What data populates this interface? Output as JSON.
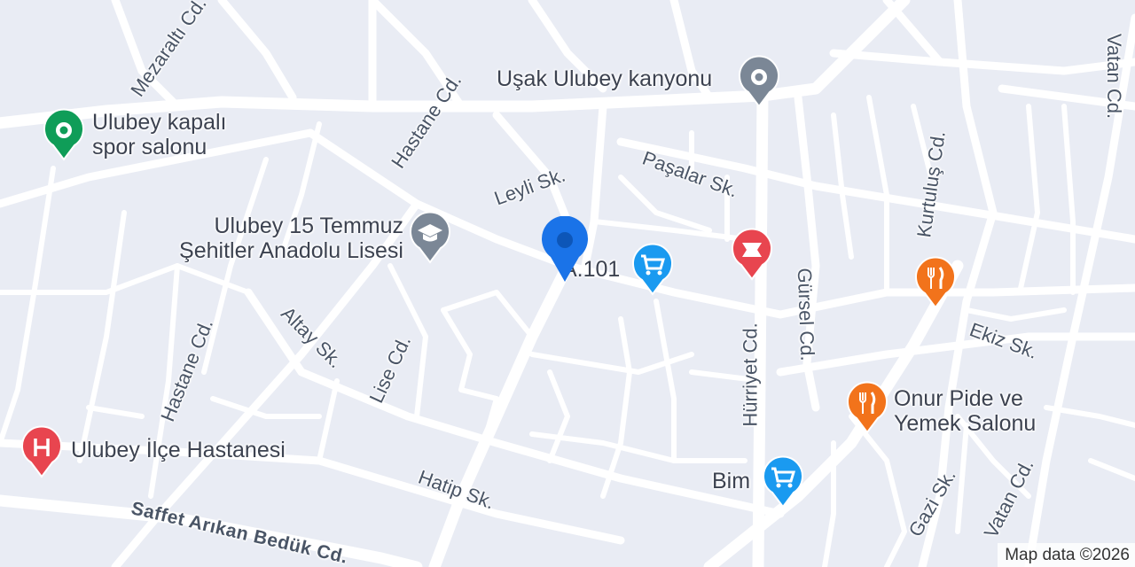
{
  "map": {
    "attribution": "Map data ©2026",
    "streets": {
      "mezaralti": "Mezaraltı Cd.",
      "hastane_top": "Hastane Cd.",
      "hastane_left": "Hastane Cd.",
      "leyli": "Leyli Sk.",
      "pasalar": "Paşalar Sk.",
      "kurtulus": "Kurtuluş Cd.",
      "vatan_top": "Vatan Cd.",
      "vatan_bottom": "Vatan Cd.",
      "gursel": "Gürsel Cd.",
      "hurriyet": "Hürriyet Cd.",
      "ekiz": "Ekiz Sk.",
      "altay": "Altay Sk.",
      "lise": "Lise Cd.",
      "hatip": "Hatip Sk.",
      "saffet": "Saffet Arıkan Bedük Cd.",
      "gazi": "Gazi Sk."
    },
    "pois": {
      "kanyon": "Uşak Ulubey kanyonu",
      "spor_line1": "Ulubey kapalı",
      "spor_line2": "spor salonu",
      "lise_line1": "Ulubey 15 Temmuz",
      "lise_line2": "Şehitler Anadolu Lisesi",
      "a101": "A.101",
      "onur_line1": "Onur Pide ve",
      "onur_line2": "Yemek Salonu",
      "bim": "Bim",
      "hastane": "Ulubey İlçe Hastanesi"
    },
    "icons": {
      "kanyon": "landmark-icon",
      "spor": "sports-icon",
      "lise": "school-icon",
      "a101": "shopping-cart-icon",
      "pharmacy": "pharmacy-icon",
      "restaurant1": "restaurant-icon",
      "restaurant2": "restaurant-icon",
      "bim": "shopping-cart-icon",
      "hospital": "hospital-icon",
      "location": "location-pin-icon"
    },
    "colors": {
      "background": "#e9ecf4",
      "road": "#ffffff",
      "landmark": "#7b8796",
      "sports": "#0f9d58",
      "school": "#7b8796",
      "shopping": "#1a9af0",
      "medical": "#e8454f",
      "restaurant": "#f2731b",
      "location_pin": "#1a73e8"
    }
  }
}
